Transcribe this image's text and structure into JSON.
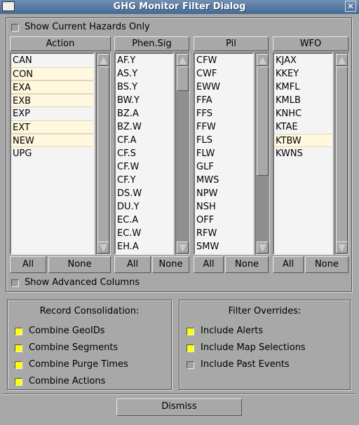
{
  "window": {
    "title": "GHG Monitor Filter Dialog",
    "close_icon": "close-icon"
  },
  "show_current_hazards": {
    "label": "Show Current Hazards Only",
    "checked": false
  },
  "columns": [
    {
      "header": "Action",
      "items": [
        "CAN",
        "CON",
        "EXA",
        "EXB",
        "EXP",
        "EXT",
        "NEW",
        "UPG"
      ],
      "selected": [
        1,
        2,
        3,
        5,
        6
      ],
      "all": "All",
      "none": "None"
    },
    {
      "header": "Phen.Sig",
      "items": [
        "AF.Y",
        "AS.Y",
        "BS.Y",
        "BW.Y",
        "BZ.A",
        "BZ.W",
        "CF.A",
        "CF.S",
        "CF.W",
        "CF.Y",
        "DS.W",
        "DU.Y",
        "EC.A",
        "EC.W",
        "EH.A"
      ],
      "selected": [],
      "all": "All",
      "none": "None"
    },
    {
      "header": "Pil",
      "items": [
        "CFW",
        "CWF",
        "EWW",
        "FFA",
        "FFS",
        "FFW",
        "FLS",
        "FLW",
        "GLF",
        "MWS",
        "NPW",
        "NSH",
        "OFF",
        "RFW",
        "SMW"
      ],
      "selected": [],
      "all": "All",
      "none": "None"
    },
    {
      "header": "WFO",
      "items": [
        "KJAX",
        "KKEY",
        "KMFL",
        "KMLB",
        "KNHC",
        "KTAE",
        "KTBW",
        "KWNS"
      ],
      "selected": [
        6
      ],
      "all": "All",
      "none": "None"
    }
  ],
  "show_advanced": {
    "label": "Show Advanced Columns",
    "checked": false
  },
  "record_consolidation": {
    "title": "Record Consolidation:",
    "options": [
      {
        "label": "Combine GeoIDs",
        "checked": true
      },
      {
        "label": "Combine Segments",
        "checked": true
      },
      {
        "label": "Combine Purge Times",
        "checked": true
      },
      {
        "label": "Combine Actions",
        "checked": true
      }
    ]
  },
  "filter_overrides": {
    "title": "Filter Overrides:",
    "options": [
      {
        "label": "Include Alerts",
        "checked": true
      },
      {
        "label": "Include Map Selections",
        "checked": true
      },
      {
        "label": "Include Past Events",
        "checked": false
      }
    ]
  },
  "dismiss_label": "Dismiss",
  "colors": {
    "selected_row": "#fff7de",
    "checkbox_on": "#ffff00",
    "title_bar": "#456a94"
  }
}
